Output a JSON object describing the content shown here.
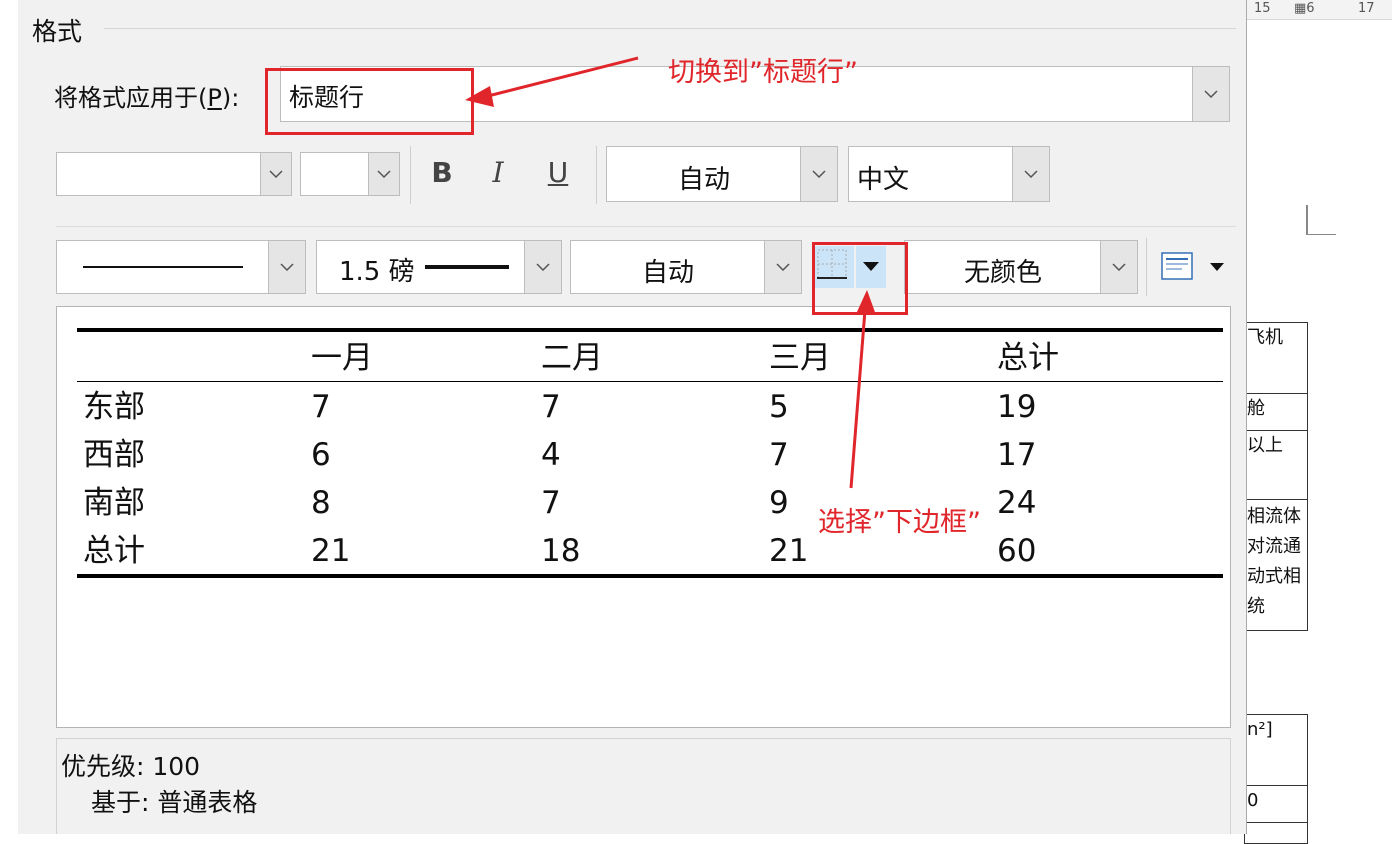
{
  "dialog": {
    "group_title": "格式",
    "apply_label_prefix": "将格式应用于(",
    "apply_label_key": "P",
    "apply_label_suffix": "):",
    "apply_value": "标题行"
  },
  "font_toolbar": {
    "font_name": "",
    "font_size": "",
    "bold": "B",
    "italic": "I",
    "underline": "U",
    "font_color": "自动",
    "script": "中文"
  },
  "border_toolbar": {
    "line_weight": "1.5 磅",
    "border_color": "自动",
    "shading": "无颜色"
  },
  "preview_table": {
    "headers": [
      "",
      "一月",
      "二月",
      "三月",
      "总计"
    ],
    "rows": [
      [
        "东部",
        "7",
        "7",
        "5",
        "19"
      ],
      [
        "西部",
        "6",
        "4",
        "7",
        "17"
      ],
      [
        "南部",
        "8",
        "7",
        "9",
        "24"
      ],
      [
        "总计",
        "21",
        "18",
        "21",
        "60"
      ]
    ]
  },
  "description": {
    "priority": "优先级: 100",
    "based_on": "基于: 普通表格"
  },
  "annotations": {
    "note1": "切换到”标题行”",
    "note2": "选择”下边框”"
  },
  "background_doc": {
    "ruler": [
      "15",
      "6",
      "17"
    ],
    "cells": [
      "飞机",
      "舱",
      "以上",
      "相流体",
      "对流通",
      "动式相",
      "统",
      "n²]",
      "0"
    ]
  },
  "colors": {
    "annotation": "#e0262b",
    "dialog_bg": "#f1f1f1",
    "selected_button": "#cce4f7"
  }
}
